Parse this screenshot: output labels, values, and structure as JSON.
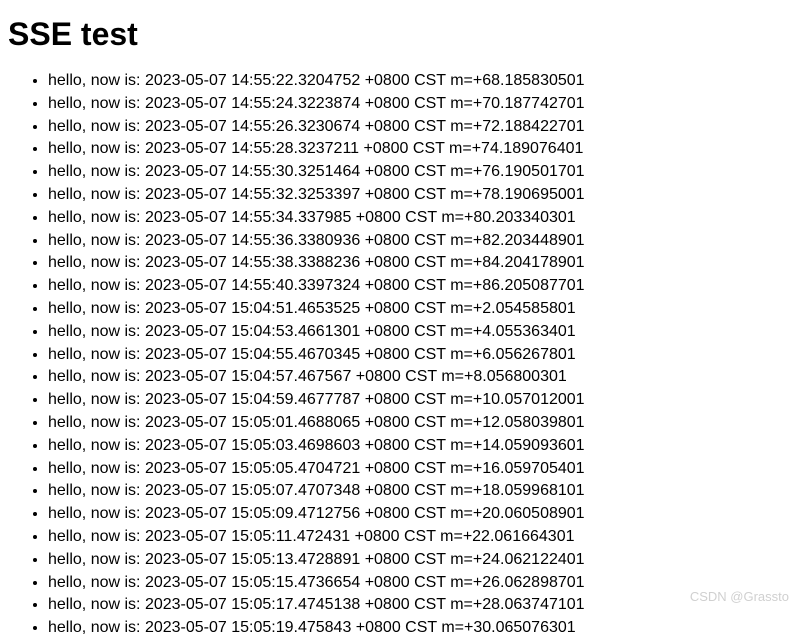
{
  "title": "SSE test",
  "messages": [
    "hello, now is: 2023-05-07 14:55:22.3204752 +0800 CST m=+68.185830501",
    "hello, now is: 2023-05-07 14:55:24.3223874 +0800 CST m=+70.187742701",
    "hello, now is: 2023-05-07 14:55:26.3230674 +0800 CST m=+72.188422701",
    "hello, now is: 2023-05-07 14:55:28.3237211 +0800 CST m=+74.189076401",
    "hello, now is: 2023-05-07 14:55:30.3251464 +0800 CST m=+76.190501701",
    "hello, now is: 2023-05-07 14:55:32.3253397 +0800 CST m=+78.190695001",
    "hello, now is: 2023-05-07 14:55:34.337985 +0800 CST m=+80.203340301",
    "hello, now is: 2023-05-07 14:55:36.3380936 +0800 CST m=+82.203448901",
    "hello, now is: 2023-05-07 14:55:38.3388236 +0800 CST m=+84.204178901",
    "hello, now is: 2023-05-07 14:55:40.3397324 +0800 CST m=+86.205087701",
    "hello, now is: 2023-05-07 15:04:51.4653525 +0800 CST m=+2.054585801",
    "hello, now is: 2023-05-07 15:04:53.4661301 +0800 CST m=+4.055363401",
    "hello, now is: 2023-05-07 15:04:55.4670345 +0800 CST m=+6.056267801",
    "hello, now is: 2023-05-07 15:04:57.467567 +0800 CST m=+8.056800301",
    "hello, now is: 2023-05-07 15:04:59.4677787 +0800 CST m=+10.057012001",
    "hello, now is: 2023-05-07 15:05:01.4688065 +0800 CST m=+12.058039801",
    "hello, now is: 2023-05-07 15:05:03.4698603 +0800 CST m=+14.059093601",
    "hello, now is: 2023-05-07 15:05:05.4704721 +0800 CST m=+16.059705401",
    "hello, now is: 2023-05-07 15:05:07.4707348 +0800 CST m=+18.059968101",
    "hello, now is: 2023-05-07 15:05:09.4712756 +0800 CST m=+20.060508901",
    "hello, now is: 2023-05-07 15:05:11.472431 +0800 CST m=+22.061664301",
    "hello, now is: 2023-05-07 15:05:13.4728891 +0800 CST m=+24.062122401",
    "hello, now is: 2023-05-07 15:05:15.4736654 +0800 CST m=+26.062898701",
    "hello, now is: 2023-05-07 15:05:17.4745138 +0800 CST m=+28.063747101",
    "hello, now is: 2023-05-07 15:05:19.475843 +0800 CST m=+30.065076301"
  ],
  "watermark": "CSDN @Grassto"
}
